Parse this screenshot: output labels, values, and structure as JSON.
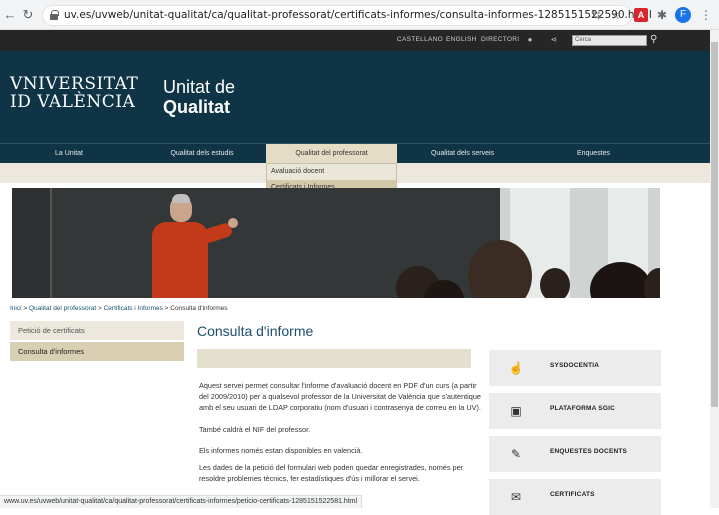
{
  "browser": {
    "url": "uv.es/uvweb/unitat-qualitat/ca/qualitat-professorat/certificats-informes/consulta-informes-1285151522590.html",
    "avatar_letter": "F",
    "status_url": "www.uv.es/uvweb/unitat-qualitat/ca/qualitat-professorat/certificats-informes/peticio-certificats-1285151522581.html"
  },
  "topbar": {
    "languages": [
      "CASTELLANO",
      "ENGLISH",
      "DIRECTORI"
    ],
    "search_placeholder": "Cerca"
  },
  "header": {
    "logo_line1": "VNIVERSITAT",
    "logo_line2": "ID VALÈNCIA",
    "title_line1": "Unitat de",
    "title_line2": "Qualitat"
  },
  "nav": {
    "items": [
      "La Unitat",
      "Qualitat dels estudis",
      "Qualitat del professorat",
      "Qualitat dels serveis",
      "Enquestes"
    ],
    "dropdown": [
      "Avaluació docent",
      "Certificats i Informes"
    ]
  },
  "breadcrumb": {
    "items": [
      "Inici",
      "Qualitat del professorat",
      "Certificats i Informes",
      "Consulta d'informes"
    ],
    "separator": ">"
  },
  "sidenav": {
    "items": [
      "Petició de certificats",
      "Consulta d'informes"
    ]
  },
  "content": {
    "title": "Consulta d'informe",
    "p1": "Aquest servei permet consultar l'informe d'avaluació docent en PDF d'un curs (a partir del 2009/2010) per a qualsevol professor de la Universitat de València que s'autentique amb el seu usuari de LDAP corporatiu (nom d'usuari i contrasenya de correu en la UV).",
    "p1b": "També caldrà el NIF del professor.",
    "p2": "Els informes només estan disponibles en valencià.",
    "p3": "Les dades de la petició del formulari web poden quedar enregistrades, només per resoldre problemes tècnics, fer estadístiques d'ús i millorar el servei."
  },
  "rightlinks": [
    {
      "label": "SYSDOCENTIA",
      "icon": "clipboard-touch-icon"
    },
    {
      "label": "PLATAFORMA SGIC",
      "icon": "monitor-hand-icon"
    },
    {
      "label": "ENQUESTES DOCENTS",
      "icon": "survey-icon"
    },
    {
      "label": "CERTIFICATS",
      "icon": "certificate-icon"
    }
  ]
}
